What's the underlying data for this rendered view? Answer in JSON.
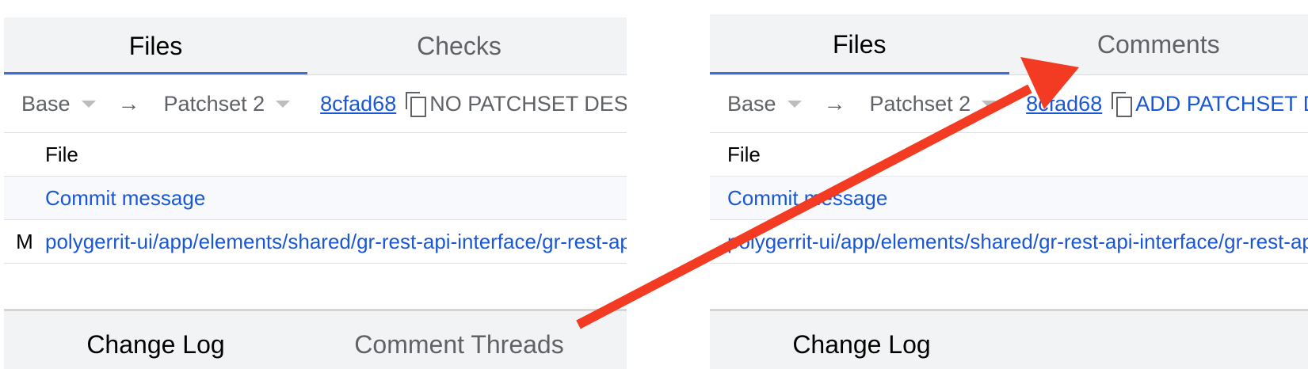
{
  "left": {
    "tabs": [
      {
        "label": "Files",
        "active": true
      },
      {
        "label": "Checks",
        "active": false
      }
    ],
    "patchset_bar": {
      "base": "Base",
      "arrow": "→",
      "patchset": "Patchset 2",
      "commit": "8cfad68",
      "description": "NO PATCHSET DESCRIPTION"
    },
    "file_table": {
      "header": "File",
      "commit_message": "Commit message",
      "file": {
        "status": "M",
        "path": "polygerrit-ui/app/elements/shared/gr-rest-api-interface/gr-rest-api-interface.ts"
      }
    },
    "bottom_tabs": [
      {
        "label": "Change Log",
        "active": true
      },
      {
        "label": "Comment Threads",
        "active": false
      }
    ]
  },
  "right": {
    "tabs": [
      {
        "label": "Files",
        "active": true
      },
      {
        "label": "Comments",
        "active": false
      }
    ],
    "patchset_bar": {
      "base": "Base",
      "arrow": "→",
      "patchset": "Patchset 2",
      "commit": "8cfad68",
      "description": "ADD PATCHSET DESCRIPTION"
    },
    "file_table": {
      "header": "File",
      "commit_message": "Commit message",
      "file": {
        "status": "",
        "path": "polygerrit-ui/app/elements/shared/gr-rest-api-interface/gr-rest-api-interface.ts"
      }
    },
    "bottom_tabs": [
      {
        "label": "Change Log",
        "active": true
      }
    ]
  },
  "annotation": {
    "color": "#f33a22"
  },
  "colors": {
    "accent": "#3b6fd4",
    "link": "#1a57d4",
    "tab_bg": "#f1f3f4"
  }
}
